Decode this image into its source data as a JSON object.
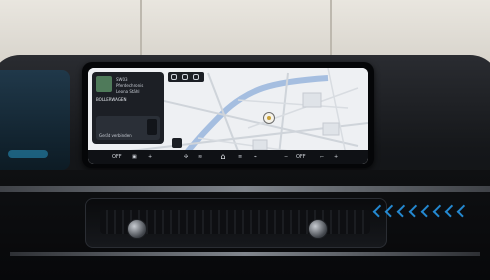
{
  "screen": {
    "status_text": "",
    "widget": {
      "media_line_1": "SW03",
      "media_line_2": "Pferdechronis",
      "media_line_3": "Leona Stähl",
      "media_title": "BOLLERWAGEN",
      "phone_label": "Gerät verbinden"
    },
    "bottom_bar": {
      "left_temp": "OFF",
      "right_temp": "OFF"
    }
  },
  "colors": {
    "ambient_light": "#2aa7ff",
    "map_background": "#e9ecef",
    "screen_bezel": "#050608"
  }
}
